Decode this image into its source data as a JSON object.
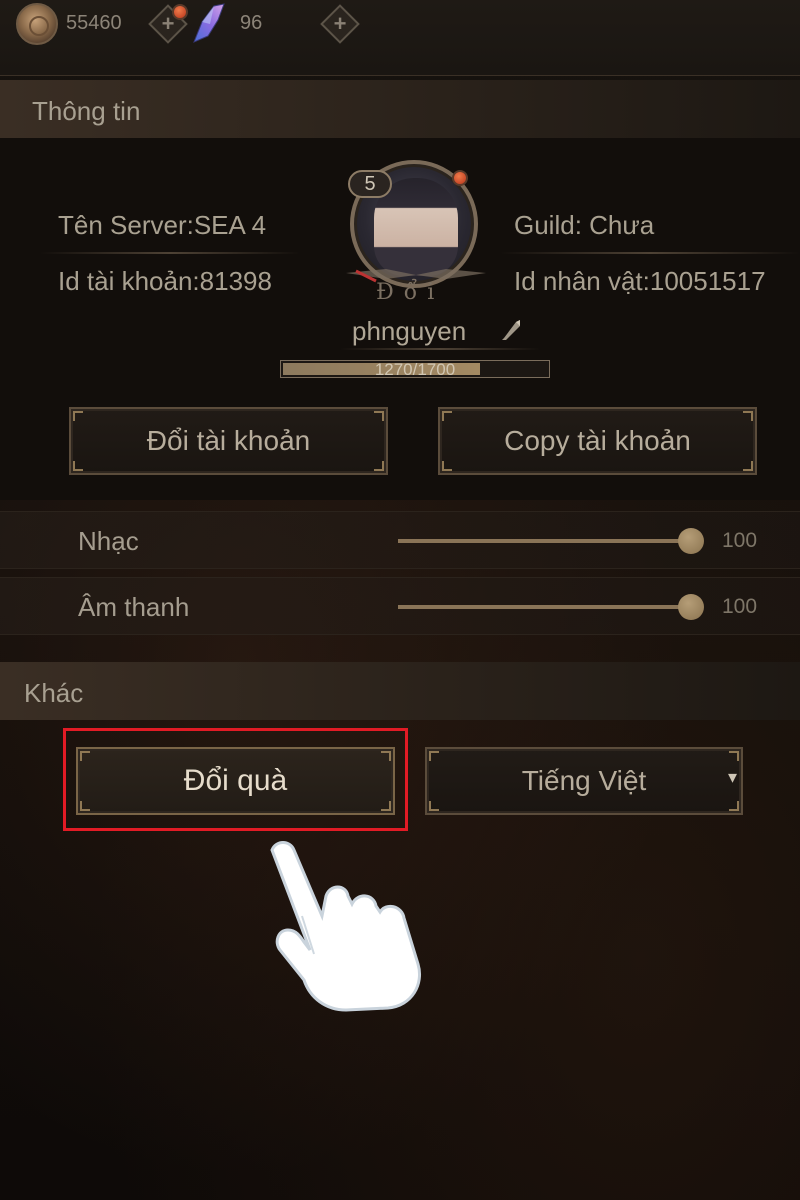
{
  "topbar": {
    "gold_amount": "55460",
    "gem_amount": "96",
    "icons": [
      "coin-icon",
      "plus-icon",
      "crystal-icon",
      "plus-icon"
    ]
  },
  "info": {
    "section_title": "Thông tin",
    "server": "Tên Server:SEA 4",
    "account_id": "Id tài khoản:81398",
    "guild": "Guild: Chưa",
    "character_id": "Id nhân vật:10051517",
    "level": "5",
    "title_text": "Đổi",
    "player_name": "phnguyen",
    "xp_text": "1270/1700",
    "xp_fraction": 0.747
  },
  "actions": {
    "switch_account": "Đổi tài khoản",
    "copy_account": "Copy tài khoản"
  },
  "settings": {
    "music_label": "Nhạc",
    "music_value": "100",
    "sound_label": "Âm thanh",
    "sound_value": "100"
  },
  "other": {
    "section_title": "Khác",
    "redeem_button": "Đổi quà",
    "language_select": "Tiếng Việt",
    "language_arrow": "▾"
  },
  "colors": {
    "accent_gold": "#8f7854",
    "highlight_red": "#e21b25",
    "notification": "#c8452a"
  }
}
